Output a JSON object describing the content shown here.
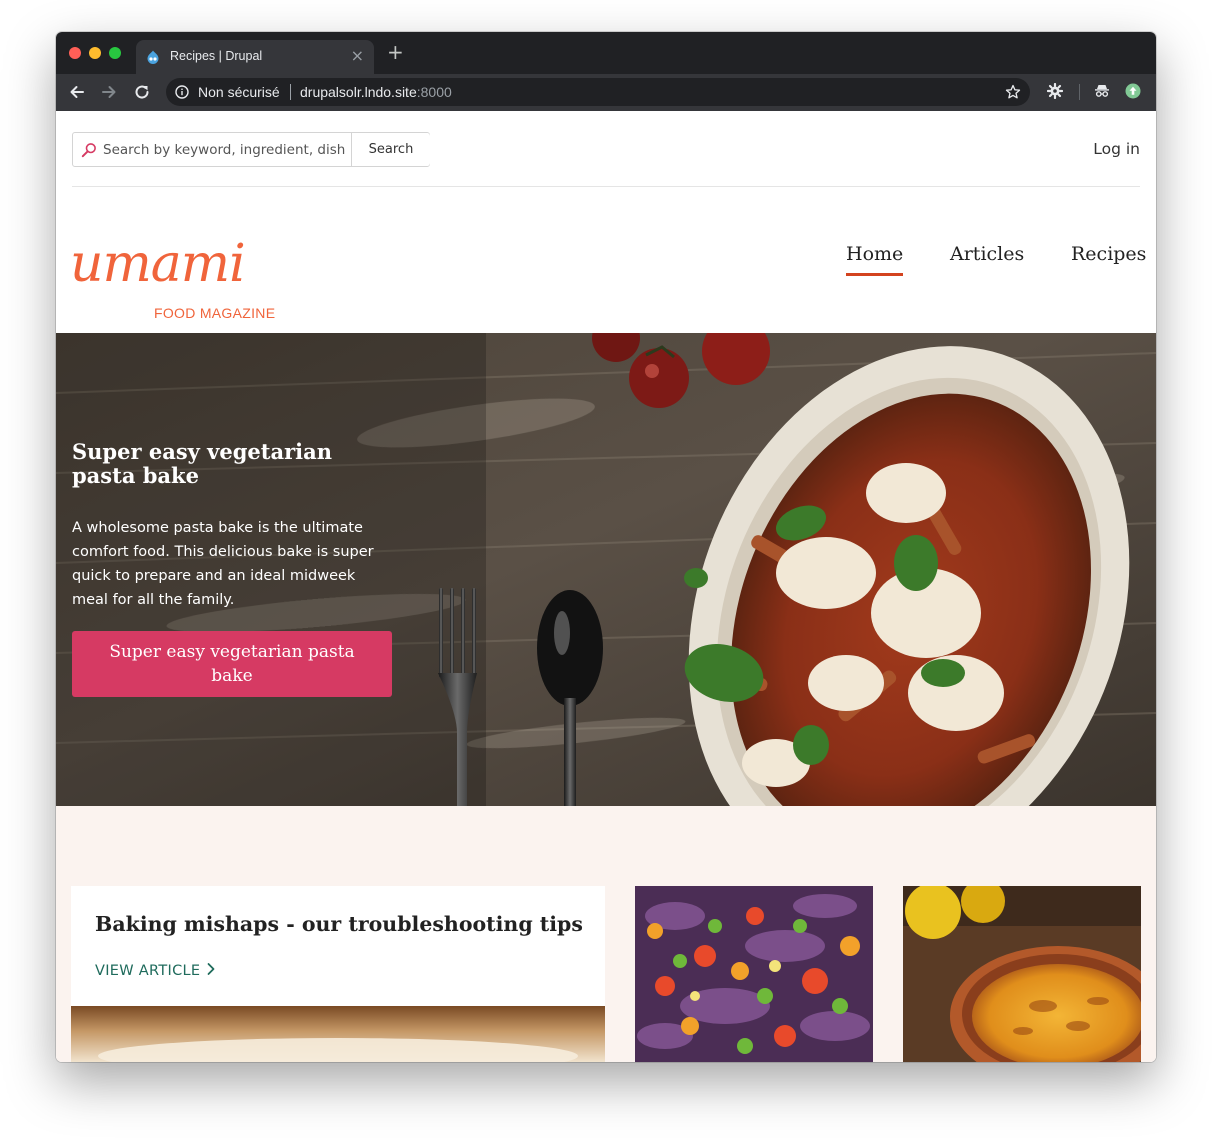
{
  "browser": {
    "tab_title": "Recipes | Drupal",
    "security_label": "Non sécurisé",
    "url_host": "drupalsolr.lndo.site",
    "url_port": ":8000"
  },
  "header": {
    "search_placeholder": "Search by keyword, ingredient, dish",
    "search_button": "Search",
    "login": "Log in"
  },
  "logo": {
    "word": "umami",
    "tagline": "FOOD MAGAZINE",
    "color": "#f0643b"
  },
  "nav": {
    "items": [
      {
        "label": "Home",
        "active": true
      },
      {
        "label": "Articles",
        "active": false
      },
      {
        "label": "Recipes",
        "active": false
      }
    ]
  },
  "hero": {
    "title": "Super easy vegetarian pasta bake",
    "body": "A wholesome pasta bake is the ultimate comfort food. This delicious bake is super quick to prepare and an ideal midweek meal for all the family.",
    "cta_label": "Super easy vegetarian pasta bake",
    "cta_color": "#d63a63"
  },
  "feature_card": {
    "title": "Baking mishaps - our troubleshooting tips",
    "link": "VIEW ARTICLE"
  },
  "colors": {
    "nav_active_underline": "#d3431f",
    "link_teal": "#1f6b5c",
    "cards_background": "#fbf3ef"
  },
  "icons": [
    "drupal-favicon-icon",
    "close-icon",
    "plus-icon",
    "back-arrow-icon",
    "forward-arrow-icon",
    "reload-icon",
    "info-icon",
    "star-icon",
    "gear-extension-icon",
    "incognito-extension-icon",
    "update-extension-icon",
    "search-icon",
    "chevron-right-icon"
  ]
}
